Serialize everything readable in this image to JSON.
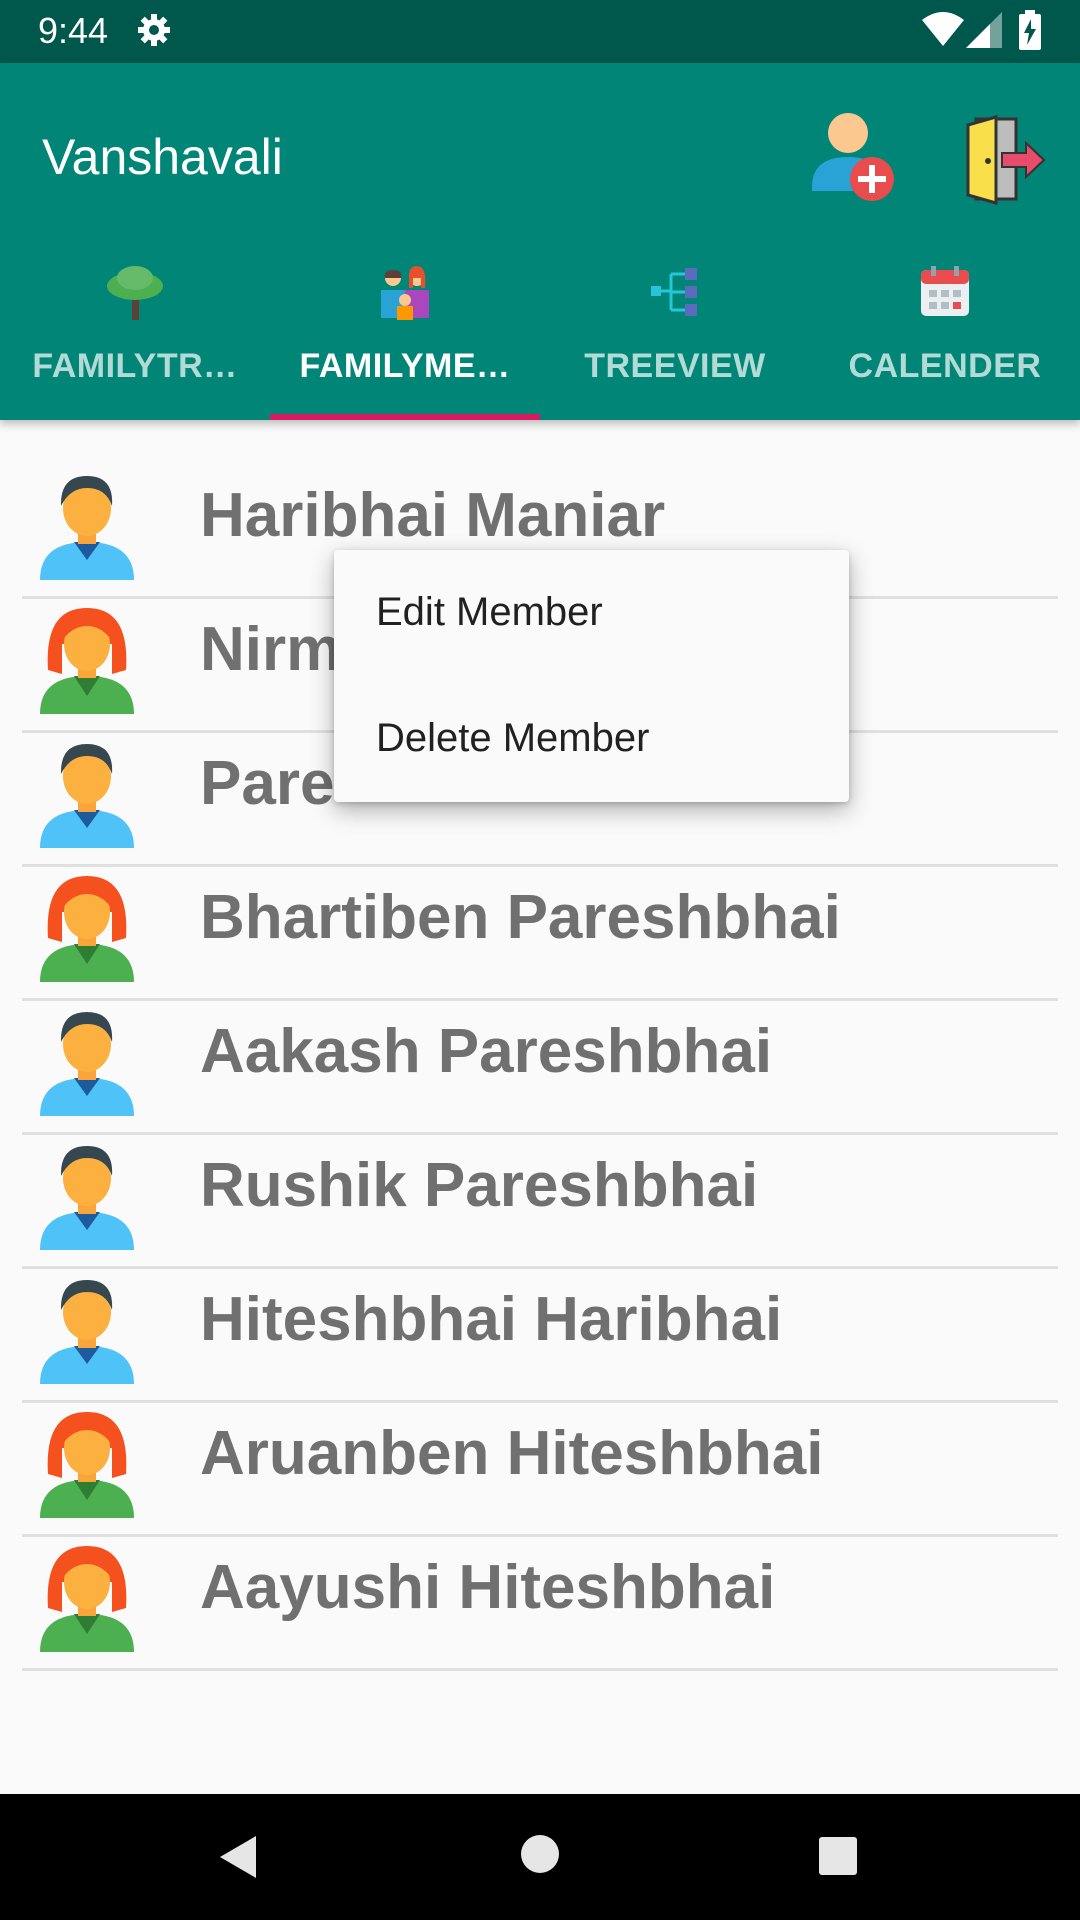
{
  "status_bar": {
    "time": "9:44",
    "icons": [
      "gear-icon",
      "wifi-icon",
      "signal-icon",
      "battery-charging-icon"
    ]
  },
  "app_bar": {
    "title": "Vanshavali",
    "actions": [
      "add-member-icon",
      "logout-door-icon"
    ],
    "colors": {
      "primary": "#008577",
      "primary_dark": "#00574b",
      "accent": "#d81b60"
    }
  },
  "tabs": [
    {
      "label": "FAMILYTR…",
      "icon": "tree-icon",
      "active": false
    },
    {
      "label": "FAMILYME…",
      "icon": "family-icon",
      "active": true
    },
    {
      "label": "TREEVIEW",
      "icon": "hierarchy-icon",
      "active": false
    },
    {
      "label": "CALENDER",
      "icon": "calendar-icon",
      "active": false
    }
  ],
  "members": [
    {
      "name": "Haribhai Maniar",
      "avatar": "male-avatar-icon"
    },
    {
      "name": "Nirm",
      "avatar": "female-avatar-icon"
    },
    {
      "name": "Pare",
      "avatar": "male-avatar-icon"
    },
    {
      "name": "Bhartiben Pareshbhai",
      "avatar": "female-avatar-icon"
    },
    {
      "name": "Aakash Pareshbhai",
      "avatar": "male-avatar-icon"
    },
    {
      "name": "Rushik Pareshbhai",
      "avatar": "male-avatar-icon"
    },
    {
      "name": "Hiteshbhai Haribhai",
      "avatar": "male-avatar-icon"
    },
    {
      "name": "Aruanben Hiteshbhai",
      "avatar": "female-avatar-icon"
    },
    {
      "name": "Aayushi Hiteshbhai",
      "avatar": "female-avatar-icon"
    }
  ],
  "context_menu": {
    "items": [
      "Edit Member",
      "Delete Member"
    ]
  },
  "nav_bar": {
    "buttons": [
      "back-icon",
      "home-icon",
      "recents-icon"
    ]
  }
}
